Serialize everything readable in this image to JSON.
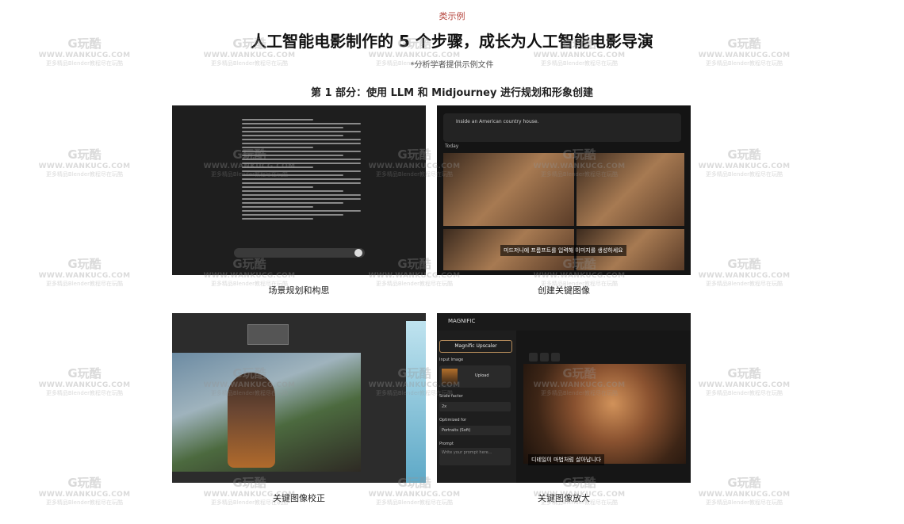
{
  "header": {
    "tag": "类示例",
    "title": "人工智能电影制作的 5 个步骤，成长为人工智能电影导演",
    "subtitle": "*分析学者提供示例文件"
  },
  "section": {
    "title": "第 1 部分：使用 LLM 和 Midjourney 进行规划和形象创建"
  },
  "cards": [
    {
      "caption": "场景规划和构思"
    },
    {
      "caption": "创建关键图像",
      "prompt": "Inside an American country house.",
      "feed_label": "Today",
      "overlay_text": "미드저니에 프롬프트를 입력해 이미지를 생성하세요"
    },
    {
      "caption": "关键图像校正"
    },
    {
      "caption": "关键图像放大",
      "brand": "MAGNIFIC",
      "upscale_button": "Magnific Upscaler",
      "input_image_label": "Input Image",
      "upload_label": "Upload",
      "scale_factor_label": "Scale factor",
      "scale_factor_value": "2x",
      "optimized_for_label": "Optimized for",
      "optimized_for_value": "Portraits (Soft)",
      "prompt_label": "Prompt",
      "prompt_placeholder": "Write your prompt here...",
      "overlay_text": "디테일이 마법처럼 살아납니다"
    }
  ],
  "watermark": {
    "logo": "G玩酷",
    "url": "WWW.WANKUCG.COM",
    "desc": "更多精品Blender教程尽在玩酷"
  }
}
